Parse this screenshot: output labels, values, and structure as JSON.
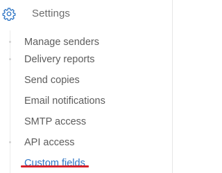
{
  "header": {
    "title": "Settings",
    "icon": "gear-icon"
  },
  "menu": {
    "items": [
      {
        "label": "Manage senders"
      },
      {
        "label": "Delivery reports"
      },
      {
        "label": "Send copies"
      },
      {
        "label": "Email notifications"
      },
      {
        "label": "SMTP access"
      },
      {
        "label": "API access"
      },
      {
        "label": "Custom fields",
        "active": true
      }
    ]
  },
  "colors": {
    "text": "#5c5c5c",
    "header_text": "#6b6b6b",
    "icon": "#2d74c4",
    "active_link": "#2d74c4",
    "active_underline": "#d6212b"
  }
}
